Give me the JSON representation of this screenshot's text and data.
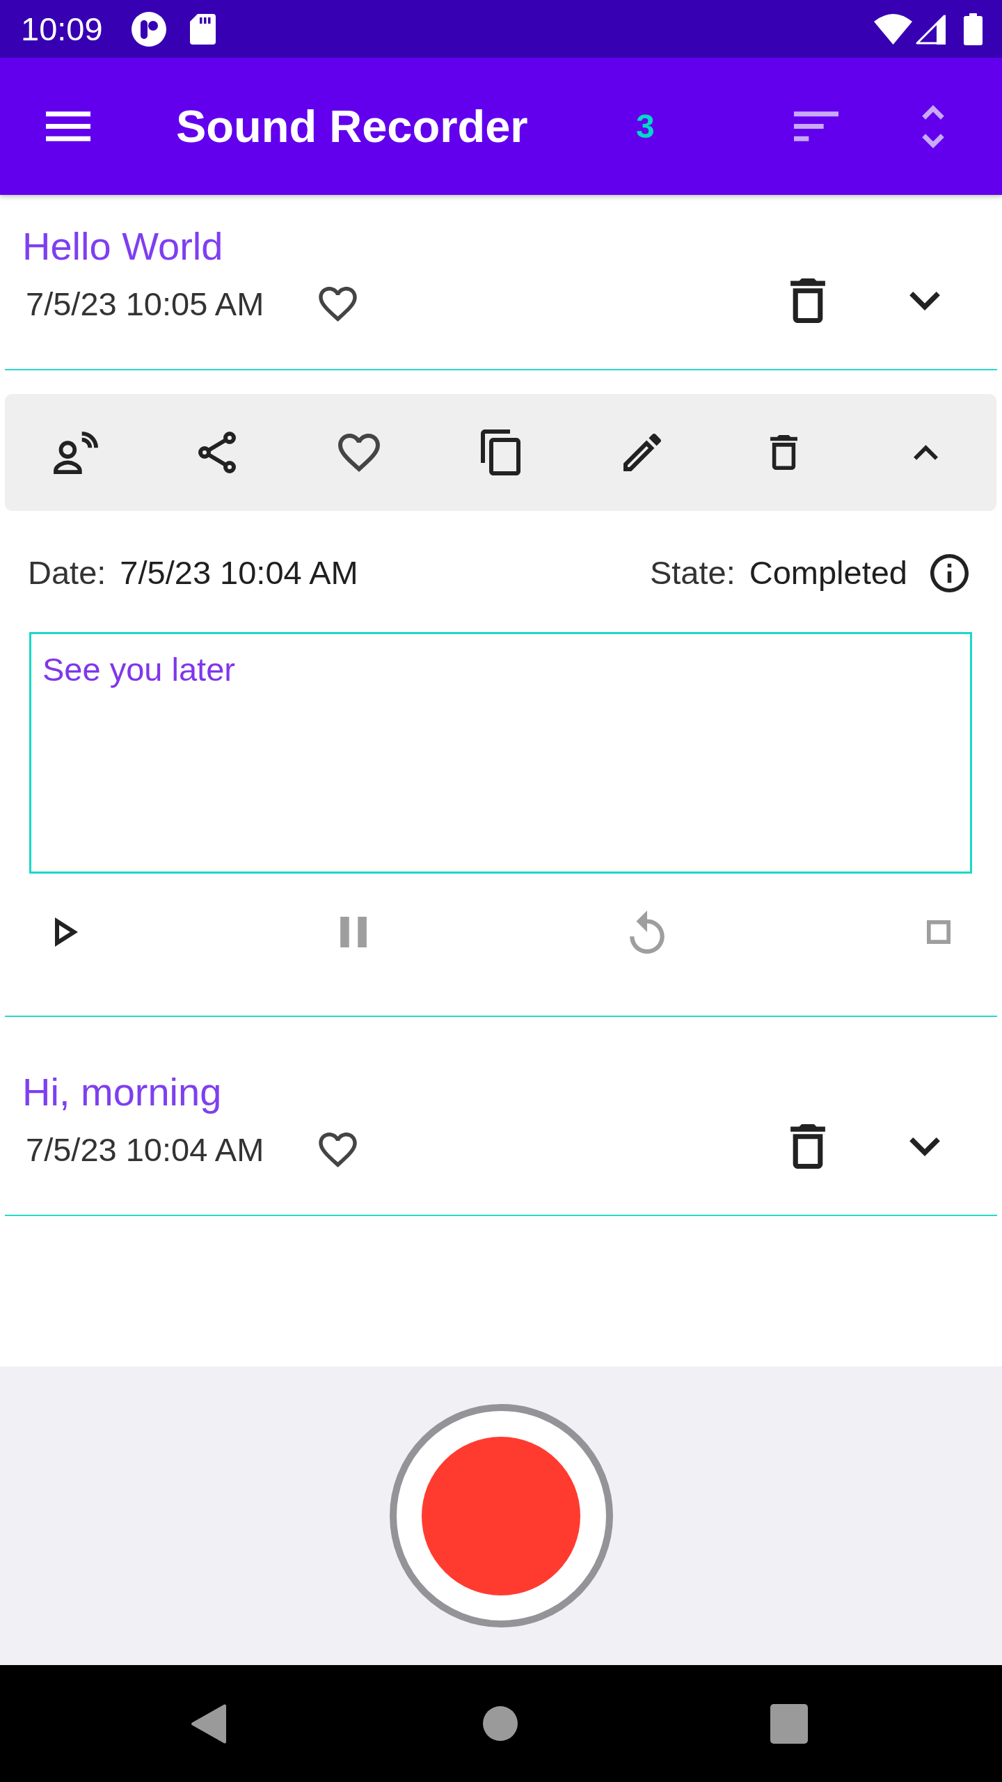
{
  "status_bar": {
    "time": "10:09"
  },
  "app_bar": {
    "title": "Sound Recorder",
    "count": "3",
    "actions": [
      {
        "kind": "sort",
        "disabled": true
      },
      {
        "kind": "unfold",
        "disabled": true
      }
    ]
  },
  "recordings": [
    {
      "title": "Hello World",
      "date": "7/5/23 10:05 AM",
      "favorite": false,
      "expanded": false
    },
    {
      "expanded": true,
      "favorite": false,
      "date_label": "Date:",
      "date": "7/5/23 10:04 AM",
      "state_label": "State:",
      "state": "Completed",
      "note": "See you later",
      "playback": [
        {
          "kind": "play",
          "disabled": false
        },
        {
          "kind": "pause",
          "disabled": true
        },
        {
          "kind": "replay",
          "disabled": true
        },
        {
          "kind": "stop",
          "disabled": true
        }
      ]
    },
    {
      "title": "Hi, morning",
      "date": "7/5/23 10:04 AM",
      "favorite": false,
      "expanded": false
    }
  ]
}
